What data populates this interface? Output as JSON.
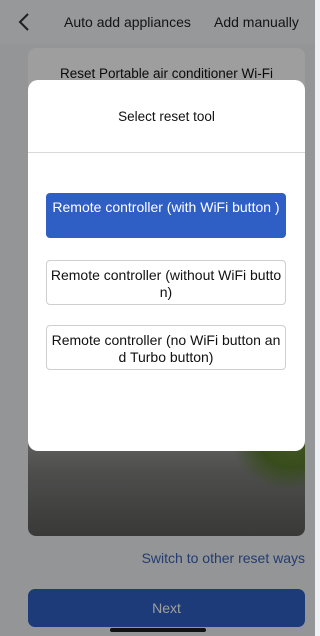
{
  "header": {
    "tab_auto": "Auto add appliances",
    "tab_manual": "Add manually"
  },
  "card": {
    "title": "Reset Portable air conditioner Wi-Fi"
  },
  "switch_link": "Switch to other reset ways",
  "next_label": "Next",
  "dialog": {
    "title": "Select reset tool",
    "options": [
      {
        "label": "Remote controller (with WiFi button )",
        "selected": true
      },
      {
        "label": "Remote controller (without WiFi button)",
        "selected": false
      },
      {
        "label": "Remote controller (no WiFi button and Turbo button)",
        "selected": false
      }
    ]
  },
  "colors": {
    "accent": "#2f5fc4",
    "link": "#3a62b8"
  }
}
